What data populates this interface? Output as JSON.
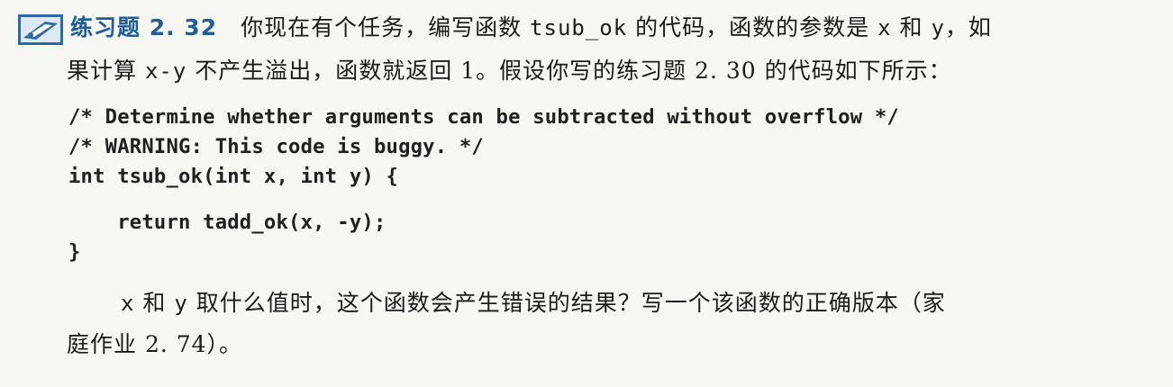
{
  "exercise": {
    "icon": "exercise-pencil-icon",
    "label": "练习题 2. 32",
    "accent_color": "#1f5e9c"
  },
  "paragraph1": {
    "line1_part1": "你现在有个任务，编写函数 ",
    "func_name": "tsub_ok",
    "line1_part2": " 的代码，函数的参数是 ",
    "arg_x": "x",
    "line1_part3": " 和 ",
    "arg_y": "y",
    "line1_part4": "，如",
    "line2_part1": "果计算 ",
    "expr": "x-y",
    "line2_part2": " 不产生溢出，函数就返回 1。假设你写的练习题 2. 30 的代码如下所示："
  },
  "code": {
    "lines": [
      "/* Determine whether arguments can be subtracted without overflow */",
      "/* WARNING: This code is buggy. */",
      "int tsub_ok(int x, int y) {",
      "",
      "    return tadd_ok(x, -y);",
      "}"
    ]
  },
  "paragraph2": {
    "line1_part1": "x",
    "line1_part2": " 和 ",
    "line1_part3": "y",
    "line1_part4": " 取什么值时，这个函数会产生错误的结果？写一个该函数的正确版本（家",
    "line2": "庭作业 2. 74）。"
  }
}
